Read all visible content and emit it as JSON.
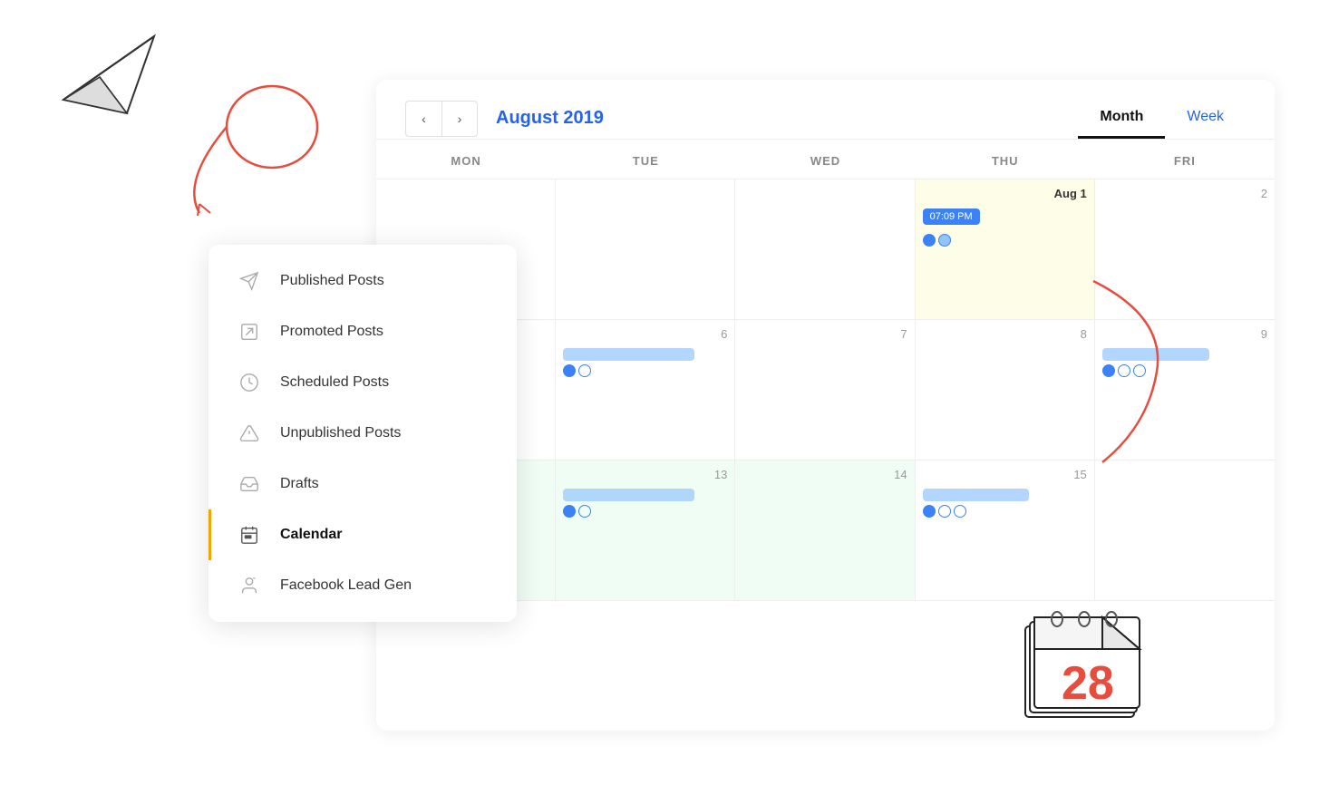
{
  "decorations": {
    "paperPlane": "paper-plane",
    "redCircle": "red-circle-decoration",
    "calendarNotebook": "calendar-notebook",
    "rightArc": "right-arc-decoration"
  },
  "sidebar": {
    "items": [
      {
        "id": "published-posts",
        "label": "Published Posts",
        "icon": "send-icon",
        "active": false
      },
      {
        "id": "promoted-posts",
        "label": "Promoted Posts",
        "icon": "arrow-up-right-icon",
        "active": false
      },
      {
        "id": "scheduled-posts",
        "label": "Scheduled Posts",
        "icon": "clock-icon",
        "active": false
      },
      {
        "id": "unpublished-posts",
        "label": "Unpublished Posts",
        "icon": "warning-icon",
        "active": false
      },
      {
        "id": "drafts",
        "label": "Drafts",
        "icon": "inbox-icon",
        "active": false
      },
      {
        "id": "calendar",
        "label": "Calendar",
        "icon": "calendar-icon",
        "active": true
      },
      {
        "id": "facebook-lead-gen",
        "label": "Facebook Lead Gen",
        "icon": "person-icon",
        "active": false
      }
    ]
  },
  "calendar": {
    "title": "August 2019",
    "viewTabs": [
      {
        "id": "month",
        "label": "Month",
        "active": true
      },
      {
        "id": "week",
        "label": "Week",
        "active": false,
        "blue": true
      }
    ],
    "dayHeaders": [
      "MON",
      "TUE",
      "WED",
      "THU",
      "FRI"
    ],
    "cells": [
      {
        "date": "",
        "highlighted": false,
        "lightGreen": false,
        "row": 1
      },
      {
        "date": "",
        "highlighted": false,
        "lightGreen": false,
        "row": 1
      },
      {
        "date": "",
        "highlighted": false,
        "lightGreen": false,
        "row": 1
      },
      {
        "date": "Aug 1",
        "highlighted": true,
        "lightGreen": false,
        "timeBadge": "07:09 PM",
        "hasSocialIcons": true,
        "row": 1
      },
      {
        "date": "2",
        "highlighted": false,
        "lightGreen": false,
        "row": 1
      },
      {
        "date": "",
        "highlighted": false,
        "lightGreen": false,
        "row": 2
      },
      {
        "date": "6",
        "highlighted": false,
        "lightGreen": false,
        "hasBar": true,
        "barIcons": "2",
        "row": 2
      },
      {
        "date": "7",
        "highlighted": false,
        "lightGreen": false,
        "row": 2
      },
      {
        "date": "8",
        "highlighted": false,
        "lightGreen": false,
        "row": 2
      },
      {
        "date": "9",
        "highlighted": false,
        "lightGreen": false,
        "hasBar": true,
        "barIcons": "3",
        "row": 2
      },
      {
        "date": "",
        "highlighted": false,
        "lightGreen": true,
        "row": 3
      },
      {
        "date": "13",
        "highlighted": false,
        "lightGreen": true,
        "hasBar": true,
        "barIcons": "2",
        "row": 3
      },
      {
        "date": "14",
        "highlighted": false,
        "lightGreen": true,
        "row": 3
      },
      {
        "date": "15",
        "highlighted": false,
        "lightGreen": false,
        "hasBar": true,
        "barIcons": "3",
        "row": 3
      },
      {
        "date": "",
        "highlighted": false,
        "lightGreen": false,
        "row": 3
      }
    ],
    "timeBadge": "07:09 PM"
  }
}
